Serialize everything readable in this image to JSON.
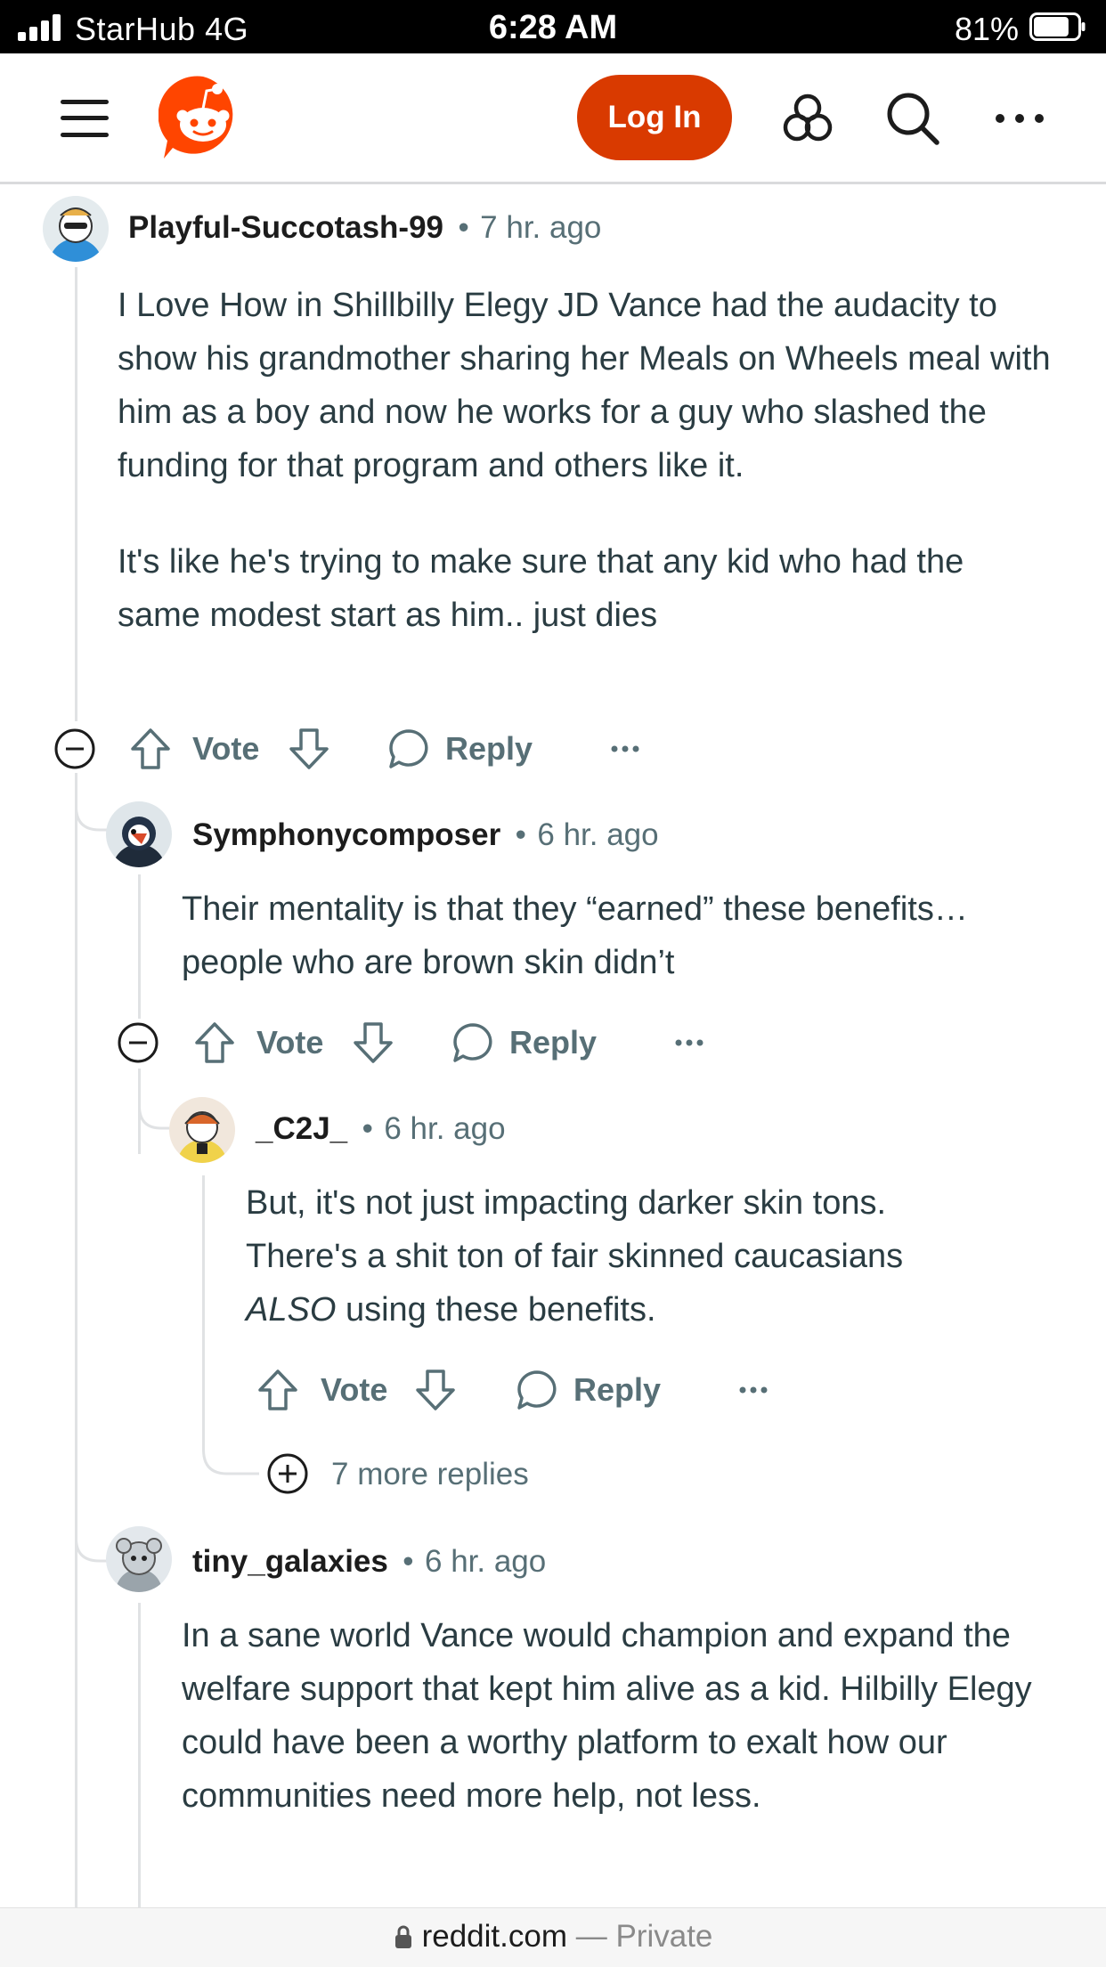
{
  "status_bar": {
    "carrier": "StarHub  4G",
    "time": "6:28 AM",
    "battery": "81%",
    "battery_level": 0.81
  },
  "header": {
    "login_label": "Log In",
    "icons": [
      "menu-icon",
      "reddit-logo",
      "explore-icon",
      "search-icon",
      "more-icon"
    ]
  },
  "comments": [
    {
      "author": "Playful-Succotash-99",
      "time": "7 hr. ago",
      "paragraphs": [
        "I Love How in Shillbilly Elegy JD Vance had the audacity to show his grandmother sharing her Meals on Wheels meal with him as a boy and now he works for a guy who slashed the funding for that program and others like it.",
        "It's like he's trying to make sure that any kid who had the same modest start as him.. just dies"
      ]
    },
    {
      "author": "Symphonycomposer",
      "time": "6 hr. ago",
      "paragraphs": [
        "Their mentality is that they “earned” these benefits… people who are brown skin didn’t"
      ]
    },
    {
      "author": "_C2J_",
      "time": "6 hr. ago",
      "line1": "But, it's not just impacting darker skin tons.",
      "line2": "There's a shit ton of fair skinned caucasians",
      "emph": "ALSO",
      "line3_rest": " using these benefits."
    },
    {
      "author": "tiny_galaxies",
      "time": "6 hr. ago",
      "paragraphs": [
        "In a sane world Vance would champion and expand the welfare support that kept him alive as a kid. Hilbilly Elegy could have been a worthy platform to exalt how our communities need more help, not less."
      ]
    }
  ],
  "actions": {
    "vote": "Vote",
    "reply": "Reply"
  },
  "more_replies": "7 more replies",
  "separator": "•",
  "footer": {
    "domain": "reddit.com",
    "suffix": " — Private"
  },
  "colors": {
    "brand": "#d93a00",
    "logo": "#ff4500",
    "meta": "#576f76"
  }
}
